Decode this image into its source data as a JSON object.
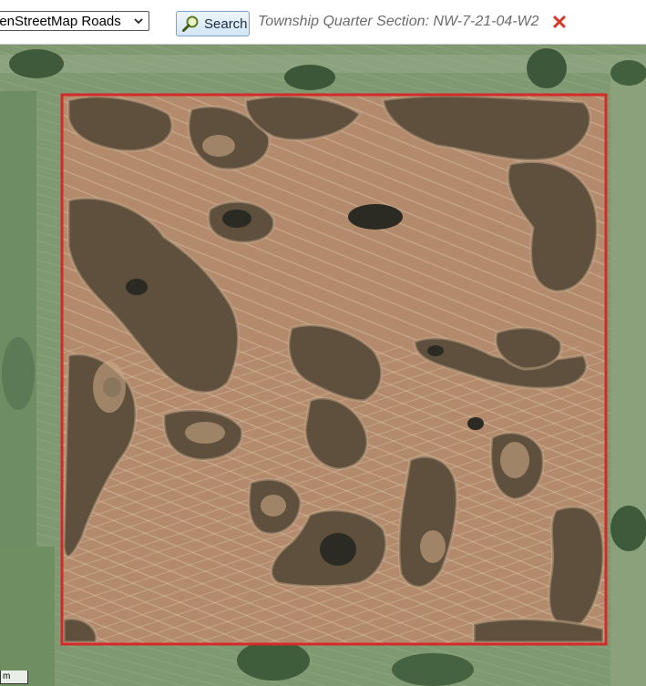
{
  "toolbar": {
    "layer_select_value": "penStreetMap Roads",
    "search_label": "Search",
    "location_text": "Township Quarter Section: NW-7-21-04-W2",
    "close_symbol": "✕"
  },
  "map": {
    "scale_label": "m",
    "highlight_color": "#d42a2a",
    "field_color": "#b38a6c",
    "grass_color": "#7f9a73"
  },
  "icons": [
    "chevron-down-icon",
    "search-magnifier-icon",
    "close-icon"
  ]
}
